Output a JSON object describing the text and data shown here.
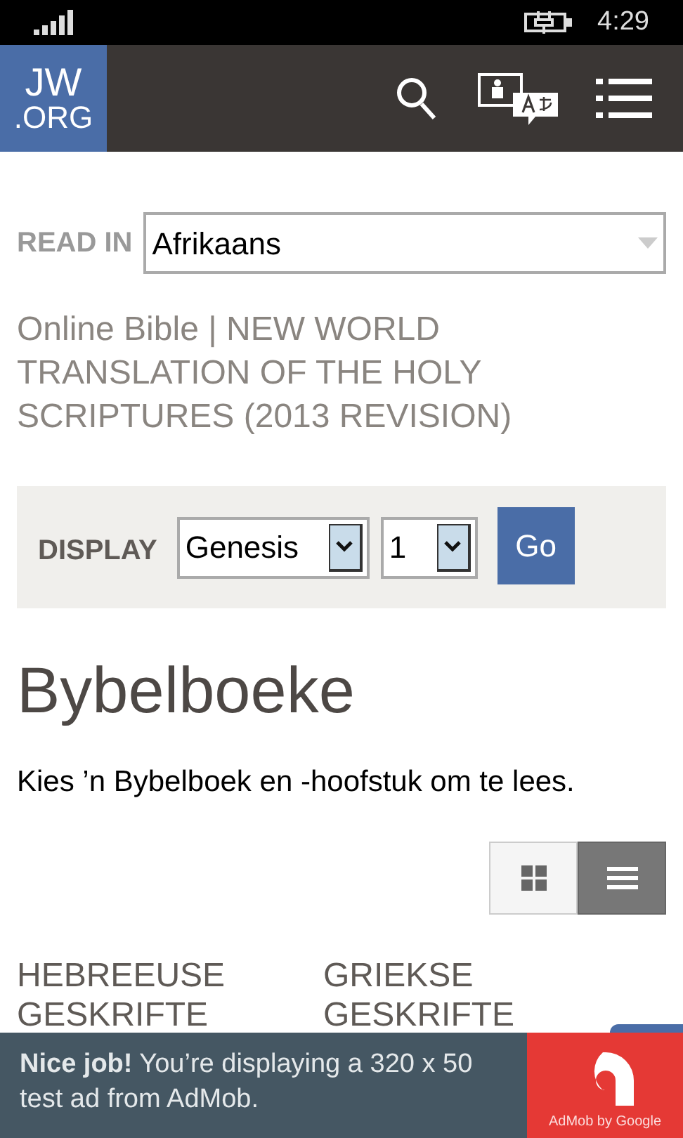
{
  "status_bar": {
    "time": "4:29"
  },
  "header": {
    "logo_top": "JW",
    "logo_bottom": ".ORG"
  },
  "read_in": {
    "label": "READ IN",
    "value": "Afrikaans"
  },
  "title": "Online Bible | NEW WORLD TRANSLATION OF THE HOLY SCRIPTURES (2013 REVISION)",
  "display": {
    "label": "DISPLAY",
    "book": "Genesis",
    "chapter": "1",
    "button": "Go"
  },
  "heading": "Bybelboeke",
  "intro": "Kies ’n Bybelboek en -hoofstuk om te lees.",
  "view_toggle": [
    {
      "kind": "grid",
      "selected": false
    },
    {
      "kind": "list",
      "selected": true
    }
  ],
  "sections": [
    {
      "line1": "HEBREEUSE",
      "line2": "GESKRIFTE"
    },
    {
      "line1": "GRIEKSE",
      "line2": "GESKRIFTE"
    }
  ],
  "ad": {
    "text": "**Nice job!** You’re displaying a 320 x 50 test ad from AdMob.",
    "brand": "AdMob by Google"
  }
}
